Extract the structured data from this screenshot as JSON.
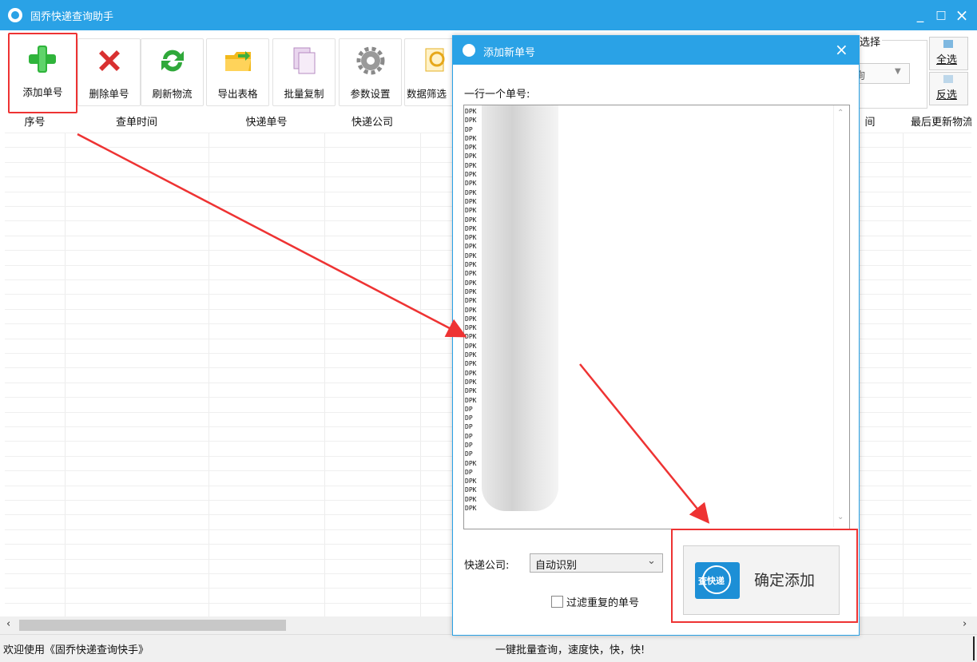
{
  "app": {
    "title": "固乔快递查询助手"
  },
  "window_controls": {
    "minimize": "_",
    "maximize": "□",
    "close": "×"
  },
  "toolbar": {
    "buttons": [
      {
        "label": "添加单号",
        "icon": "add-icon"
      },
      {
        "label": "删除单号",
        "icon": "delete-icon"
      },
      {
        "label": "刷新物流",
        "icon": "refresh-icon"
      },
      {
        "label": "导出表格",
        "icon": "folder-icon"
      },
      {
        "label": "批量复制",
        "icon": "copy-icon"
      },
      {
        "label": "参数设置",
        "icon": "gear-icon"
      },
      {
        "label": "数据筛选",
        "icon": "filter-icon"
      }
    ],
    "select_group_label": "选择",
    "select_value": "询",
    "select_all": "全选",
    "invert_select": "反选"
  },
  "table": {
    "columns": [
      "序号",
      "查单时间",
      "快递单号",
      "快递公司",
      "间",
      "最后更新物流"
    ]
  },
  "status": {
    "left": "欢迎使用《固乔快递查询快手》",
    "right": "一键批量查询，速度快，快，快!"
  },
  "dialog": {
    "title": "添加新单号",
    "close": "×",
    "instruction": "一行一个单号:",
    "tracking_numbers": [
      "DPK",
      "DPK",
      "DP",
      "DPK",
      "DPK",
      "DPK",
      "DPK",
      "DPK",
      "DPK",
      "DPK",
      "DPK",
      "DPK",
      "DPK",
      "DPK",
      "DPK",
      "DPK",
      "DPK",
      "DPK",
      "DPK",
      "DPK",
      "DPK",
      "DPK",
      "DPK",
      "DPK",
      "DPK",
      "DPK",
      "DPK",
      "DPK",
      "DPK",
      "DPK",
      "DPK",
      "DPK",
      "DPK",
      "DP",
      "DP",
      "DP",
      "DP",
      "DP",
      "DP",
      "DPK",
      "DP",
      "DPK",
      "DPK",
      "DPK",
      "DPK"
    ],
    "company_label": "快递公司:",
    "company_value": "自动识别",
    "filter_label": "过滤重复的单号",
    "confirm_label": "确定添加",
    "confirm_icon_text": "查快递"
  },
  "colors": {
    "accent": "#2aa2e6",
    "highlight": "#e33333"
  }
}
